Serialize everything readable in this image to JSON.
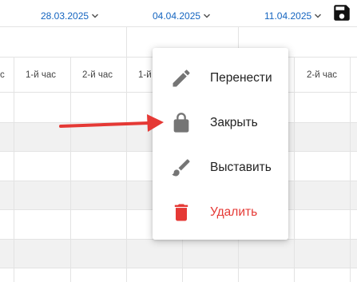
{
  "toolbar": {
    "save_icon": "save-icon"
  },
  "dates": [
    "28.03.2025",
    "04.04.2025",
    "11.04.2025"
  ],
  "sub_headers": [
    "с",
    "1-й час",
    "2-й час",
    "1-й",
    "2-й час"
  ],
  "menu": {
    "items": [
      {
        "label": "Перенести",
        "icon": "pencil-icon"
      },
      {
        "label": "Закрыть",
        "icon": "lock-icon"
      },
      {
        "label": "Выставить",
        "icon": "brush-icon"
      },
      {
        "label": "Удалить",
        "icon": "trash-icon",
        "color": "#e53935"
      }
    ]
  },
  "annotation": {
    "arrow_color": "#e53935"
  }
}
